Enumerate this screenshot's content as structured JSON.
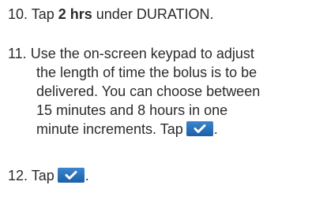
{
  "steps": [
    {
      "number": "10.",
      "text_before": "Tap ",
      "bold": "2 hrs",
      "text_after": " under DURATION."
    },
    {
      "number": "11.",
      "lines": [
        "Use the on-screen keypad to adjust",
        "the length of time the bolus is to be",
        "delivered. You can choose between",
        "15 minutes and 8 hours in one",
        "minute increments. Tap"
      ],
      "suffix": "."
    },
    {
      "number": "12.",
      "text_before": "Tap",
      "suffix": "."
    }
  ],
  "icons": {
    "confirm": "checkmark-icon"
  },
  "colors": {
    "confirm_button": "#2a72bd",
    "text": "#2b2b2b"
  }
}
